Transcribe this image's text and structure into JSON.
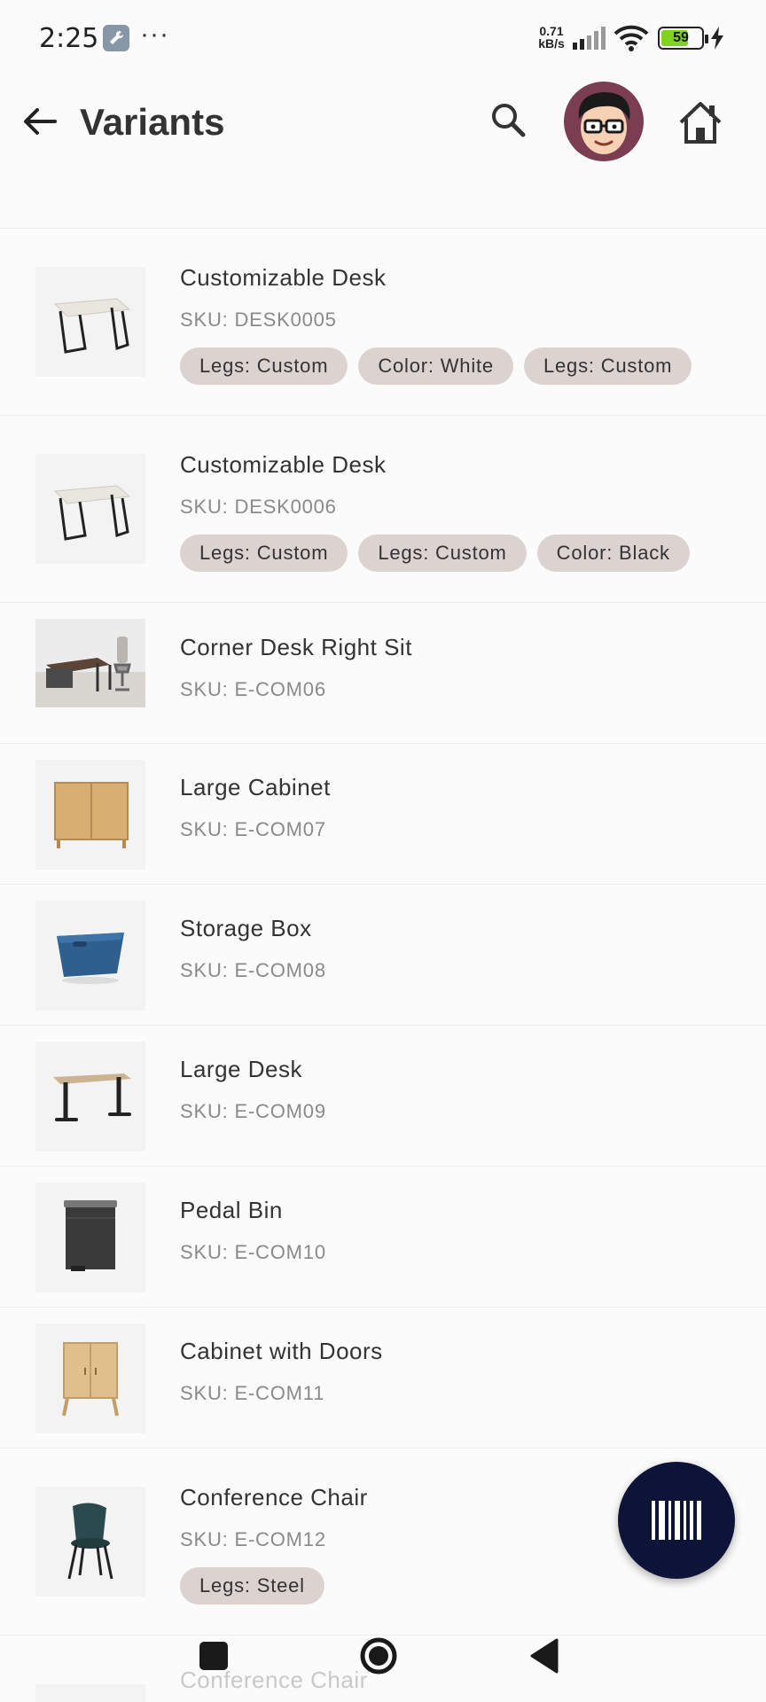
{
  "status_bar": {
    "time": "2:25",
    "more": "···",
    "speed_value": "0.71",
    "speed_unit": "kB/s",
    "battery": "59"
  },
  "app_bar": {
    "title": "Variants"
  },
  "items": [
    {
      "name": "Customizable Desk",
      "sku": "SKU: DESK0005",
      "tags": [
        "Legs: Custom",
        "Color: White",
        "Legs: Custom"
      ],
      "thumb": "desk-white-icon"
    },
    {
      "name": "Customizable Desk",
      "sku": "SKU: DESK0006",
      "tags": [
        "Legs: Custom",
        "Legs: Custom",
        "Color: Black"
      ],
      "thumb": "desk-white-icon"
    },
    {
      "name": "Corner Desk Right Sit",
      "sku": "SKU: E-COM06",
      "tags": [],
      "thumb": "corner-desk-icon"
    },
    {
      "name": "Large Cabinet",
      "sku": "SKU: E-COM07",
      "tags": [],
      "thumb": "cabinet-icon"
    },
    {
      "name": "Storage Box",
      "sku": "SKU: E-COM08",
      "tags": [],
      "thumb": "storage-box-icon"
    },
    {
      "name": "Large Desk",
      "sku": "SKU: E-COM09",
      "tags": [],
      "thumb": "standing-desk-icon"
    },
    {
      "name": "Pedal Bin",
      "sku": "SKU: E-COM10",
      "tags": [],
      "thumb": "pedal-bin-icon"
    },
    {
      "name": "Cabinet with Doors",
      "sku": "SKU: E-COM11",
      "tags": [],
      "thumb": "cabinet-doors-icon"
    },
    {
      "name": "Conference Chair",
      "sku": "SKU: E-COM12",
      "tags": [
        "Legs: Steel"
      ],
      "thumb": "chair-icon"
    }
  ],
  "partial_item": {
    "name": "Conference Chair"
  },
  "colors": {
    "accent": "#0e1338",
    "tag_bg": "#dcd3d0",
    "text": "#333333",
    "sku": "#8a8a8a"
  }
}
